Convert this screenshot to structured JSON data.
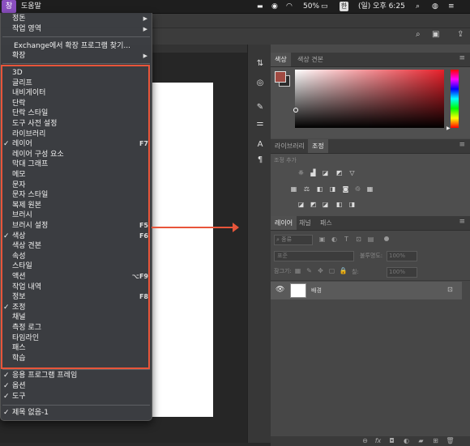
{
  "menubar": {
    "window_menu": "창",
    "help_menu": "도움말",
    "battery": "50%",
    "input_source": "한",
    "clock": "(일) 오후 6:25"
  },
  "window_menu": {
    "items_top": [
      {
        "label": "정돈",
        "submenu": true
      },
      {
        "label": "작업 영역",
        "submenu": true
      }
    ],
    "exchange": "Exchange에서 확장 프로그램 찾기...",
    "extensions": {
      "label": "확장",
      "submenu": true
    },
    "panels": [
      {
        "label": "3D",
        "checked": false,
        "shortcut": ""
      },
      {
        "label": "글리프",
        "checked": false,
        "shortcut": ""
      },
      {
        "label": "내비게이터",
        "checked": false,
        "shortcut": ""
      },
      {
        "label": "단락",
        "checked": false,
        "shortcut": ""
      },
      {
        "label": "단락 스타일",
        "checked": false,
        "shortcut": ""
      },
      {
        "label": "도구 사전 설정",
        "checked": false,
        "shortcut": ""
      },
      {
        "label": "라이브러리",
        "checked": false,
        "shortcut": ""
      },
      {
        "label": "레이어",
        "checked": true,
        "shortcut": "F7"
      },
      {
        "label": "레이어 구성 요소",
        "checked": false,
        "shortcut": ""
      },
      {
        "label": "막대 그래프",
        "checked": false,
        "shortcut": ""
      },
      {
        "label": "메모",
        "checked": false,
        "shortcut": ""
      },
      {
        "label": "문자",
        "checked": false,
        "shortcut": ""
      },
      {
        "label": "문자 스타일",
        "checked": false,
        "shortcut": ""
      },
      {
        "label": "복제 원본",
        "checked": false,
        "shortcut": ""
      },
      {
        "label": "브러시",
        "checked": false,
        "shortcut": ""
      },
      {
        "label": "브러시 설정",
        "checked": false,
        "shortcut": "F5"
      },
      {
        "label": "색상",
        "checked": true,
        "shortcut": "F6"
      },
      {
        "label": "색상 견본",
        "checked": false,
        "shortcut": ""
      },
      {
        "label": "속성",
        "checked": false,
        "shortcut": ""
      },
      {
        "label": "스타일",
        "checked": false,
        "shortcut": ""
      },
      {
        "label": "액션",
        "checked": false,
        "shortcut": "⌥F9"
      },
      {
        "label": "작업 내역",
        "checked": false,
        "shortcut": ""
      },
      {
        "label": "정보",
        "checked": false,
        "shortcut": "F8"
      },
      {
        "label": "조정",
        "checked": true,
        "shortcut": ""
      },
      {
        "label": "채널",
        "checked": false,
        "shortcut": ""
      },
      {
        "label": "측정 로그",
        "checked": false,
        "shortcut": ""
      },
      {
        "label": "타임라인",
        "checked": false,
        "shortcut": ""
      },
      {
        "label": "패스",
        "checked": false,
        "shortcut": ""
      },
      {
        "label": "학습",
        "checked": false,
        "shortcut": ""
      }
    ],
    "bottom": [
      {
        "label": "응용 프로그램 프레임",
        "checked": true
      },
      {
        "label": "옵션",
        "checked": true
      },
      {
        "label": "도구",
        "checked": true
      }
    ],
    "document": {
      "label": "제목 없음-1",
      "checked": true
    }
  },
  "right_panels": {
    "color_tabs": [
      "색상",
      "색상 견본"
    ],
    "adjust_tabs": [
      "라이브러리",
      "조정"
    ],
    "adjust_add": "조정 추가",
    "layer_tabs": [
      "레이어",
      "채널",
      "패스"
    ],
    "kind_filter": "종류",
    "blend_mode": "표준",
    "opacity_label": "불투명도:",
    "opacity_value": "100%",
    "lock_label": "잠그기:",
    "fill_label": "칠:",
    "fill_value": "100%",
    "layer_name": "배경"
  },
  "colors": {
    "accent_red": "#e8553a",
    "menu_bg": "#3c3e42",
    "foreground_swatch": "#a04a42"
  }
}
